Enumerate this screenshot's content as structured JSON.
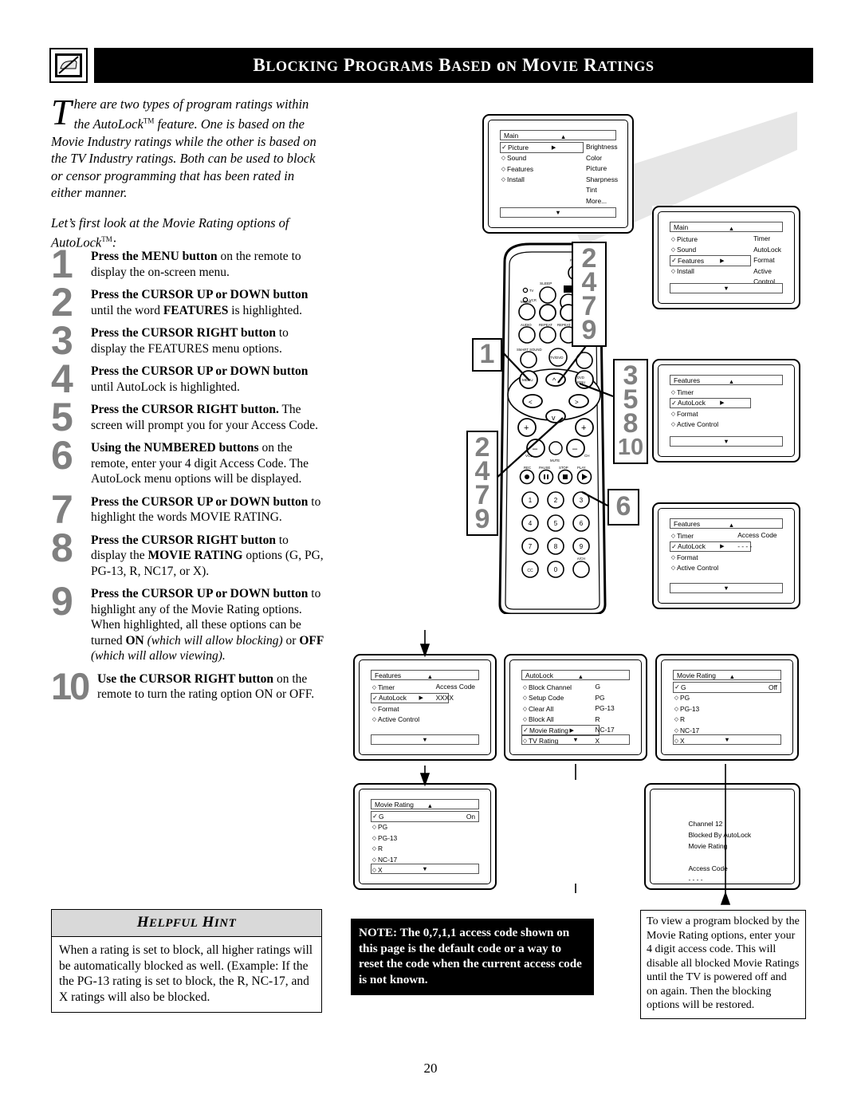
{
  "header": {
    "title": "Blocking Programs Based on Movie Ratings",
    "icon": "no-view-tv-icon"
  },
  "intro": {
    "dropcap": "T",
    "paragraph1": "here are two types of program ratings within the AutoLock™ feature. One is based on the Movie Industry ratings while the other is based on the TV Industry ratings. Both can be used to block or censor programming that has been rated in either manner.",
    "paragraph2": "Let’s first look at the Movie Rating options of AutoLock™:"
  },
  "steps": [
    {
      "num": "1",
      "html": "<b>Press the MENU button</b> on the remote to display the on-screen menu."
    },
    {
      "num": "2",
      "html": "<b>Press the CURSOR UP or DOWN button</b> until the word <b>FEATURES</b> is highlighted."
    },
    {
      "num": "3",
      "html": "<b>Press the CURSOR RIGHT button</b> to display the FEATURES menu options."
    },
    {
      "num": "4",
      "html": "<b>Press the CURSOR UP or DOWN button</b> until AutoLock is highlighted."
    },
    {
      "num": "5",
      "html": "<b>Press the CURSOR RIGHT button.</b> The screen will prompt you for your Access Code."
    },
    {
      "num": "6",
      "html": "<b>Using the NUMBERED buttons</b> on the remote, enter your 4 digit Access Code. The AutoLock menu options will be displayed."
    },
    {
      "num": "7",
      "html": "<b>Press the CURSOR UP or DOWN button</b> to highlight the words MOVIE RATING."
    },
    {
      "num": "8",
      "html": "<b>Press the CURSOR RIGHT button</b> to display the <b>MOVIE RATING</b> options (G, PG, PG-13, R, NC17, or X)."
    },
    {
      "num": "9",
      "html": "<b>Press the CURSOR UP or DOWN button</b> to highlight any of the Movie Rating options. When highlighted, all these options can be turned <b>ON</b> <i>(which will allow blocking)</i> or <b>OFF</b> <i>(which will allow viewing).</i>"
    },
    {
      "num": "10",
      "html": "<b>Use the CURSOR RIGHT button</b> on the remote to turn the rating option ON or OFF."
    }
  ],
  "hint": {
    "heading": "Helpful Hint",
    "body": "When a rating is set to block, all higher ratings will be automatically blocked as well. (Example: If the the PG-13 rating is set to block, the R, NC-17, and X ratings will also be blocked."
  },
  "note": {
    "text": "NOTE: The 0,7,1,1 access code shown on this page is the default code or a way to reset the code when the current access code is not known."
  },
  "bottom_right_note": {
    "text": "To view a program blocked by the Movie Rating options, enter your 4 digit access code. This will disable all blocked Movie Ratings until the TV is powered off and on again. Then the blocking options will be restored."
  },
  "page_number": "20",
  "callouts": [
    {
      "id": "co1",
      "values": [
        "1"
      ]
    },
    {
      "id": "co2",
      "values": [
        "2",
        "4",
        "7",
        "9"
      ]
    },
    {
      "id": "co3",
      "values": [
        "3",
        "5",
        "8",
        "10"
      ]
    },
    {
      "id": "co4",
      "values": [
        "2",
        "4",
        "7",
        "9"
      ]
    },
    {
      "id": "co5",
      "values": [
        "6"
      ]
    }
  ],
  "screens": {
    "tv1": {
      "title": "Main",
      "rows": [
        {
          "mark": "check",
          "label": "Picture",
          "arrow": true,
          "highlight": true
        },
        {
          "mark": "diamond",
          "label": "Sound"
        },
        {
          "mark": "diamond",
          "label": "Features"
        },
        {
          "mark": "diamond",
          "label": "Install"
        }
      ],
      "right_column": [
        "Brightness",
        "Color",
        "Picture",
        "Sharpness",
        "Tint",
        "More..."
      ]
    },
    "tv2": {
      "title": "Main",
      "rows": [
        {
          "mark": "diamond",
          "label": "Picture"
        },
        {
          "mark": "diamond",
          "label": "Sound"
        },
        {
          "mark": "check",
          "label": "Features",
          "arrow": true,
          "highlight": true
        },
        {
          "mark": "diamond",
          "label": "Install"
        }
      ],
      "right_column": [
        "Timer",
        "AutoLock",
        "Format",
        "Active Control"
      ]
    },
    "tv3": {
      "title": "Features",
      "rows": [
        {
          "mark": "diamond",
          "label": "Timer"
        },
        {
          "mark": "check",
          "label": "AutoLock",
          "arrow": true,
          "highlight": true
        },
        {
          "mark": "diamond",
          "label": "Format"
        },
        {
          "mark": "diamond",
          "label": "Active Control"
        }
      ],
      "right_column": []
    },
    "tv4": {
      "title": "Features",
      "rows": [
        {
          "mark": "diamond",
          "label": "Timer"
        },
        {
          "mark": "check",
          "label": "AutoLock",
          "arrow": true,
          "highlight": true
        },
        {
          "mark": "diamond",
          "label": "Format"
        },
        {
          "mark": "diamond",
          "label": "Active Control"
        }
      ],
      "right_column": [
        "Access Code",
        "- - - -"
      ]
    },
    "tv5": {
      "title": "Features",
      "rows": [
        {
          "mark": "diamond",
          "label": "Timer"
        },
        {
          "mark": "check",
          "label": "AutoLock",
          "arrow": true,
          "highlight": true
        },
        {
          "mark": "diamond",
          "label": "Format"
        },
        {
          "mark": "diamond",
          "label": "Active Control"
        }
      ],
      "right_column": [
        "Access Code",
        "XXXX"
      ]
    },
    "tv6": {
      "title": "AutoLock",
      "rows": [
        {
          "mark": "diamond",
          "label": "Block Channel"
        },
        {
          "mark": "diamond",
          "label": "Setup Code"
        },
        {
          "mark": "diamond",
          "label": "Clear All"
        },
        {
          "mark": "diamond",
          "label": "Block All"
        },
        {
          "mark": "check",
          "label": "Movie Rating",
          "arrow": true,
          "highlight": true
        },
        {
          "mark": "diamond",
          "label": "TV Rating"
        }
      ],
      "right_column": [
        "G",
        "PG",
        "PG-13",
        "R",
        "NC-17",
        "X"
      ]
    },
    "tv7": {
      "title": "Movie Rating",
      "rows": [
        {
          "mark": "check",
          "label": "G",
          "highlight": true,
          "value": "Off"
        },
        {
          "mark": "diamond",
          "label": "PG"
        },
        {
          "mark": "diamond",
          "label": "PG-13"
        },
        {
          "mark": "diamond",
          "label": "R"
        },
        {
          "mark": "diamond",
          "label": "NC-17"
        },
        {
          "mark": "diamond",
          "label": "X"
        }
      ],
      "right_column": []
    },
    "tv8": {
      "title": "Movie Rating",
      "rows": [
        {
          "mark": "check",
          "label": "G",
          "highlight": true,
          "value": "On"
        },
        {
          "mark": "diamond",
          "label": "PG"
        },
        {
          "mark": "diamond",
          "label": "PG-13"
        },
        {
          "mark": "diamond",
          "label": "R"
        },
        {
          "mark": "diamond",
          "label": "NC-17"
        },
        {
          "mark": "diamond",
          "label": "X"
        }
      ],
      "right_column": []
    },
    "tv9": {
      "message_lines": [
        "Channel 12",
        "Blocked By AutoLock",
        "Movie Rating",
        "",
        "Access Code",
        "- - - -"
      ]
    }
  },
  "remote": {
    "labels": {
      "tv": "TV",
      "vcr": "VCR",
      "mode": "MODE",
      "sleep": "SLEEP",
      "audio": "AUDIO",
      "repeat": "REPEAT",
      "repeat_ab": "REPEAT A-B",
      "smart_sound": "SMART SOUND",
      "tv_dvd": "TV/DVD",
      "menu": "MENU",
      "dvd_menu": "DVD MENU",
      "vol": "VOL",
      "ch": "CH",
      "mute": "MUTE",
      "rec": "REC",
      "pause": "PAUSE",
      "stop": "STOP",
      "play": "PLAY",
      "cc": "CC",
      "a_ch": "A/CH"
    },
    "keypad": [
      "1",
      "2",
      "3",
      "4",
      "5",
      "6",
      "7",
      "8",
      "9",
      "CC",
      "0",
      "A/CH"
    ]
  },
  "colors": {
    "accent_gray": "#808080",
    "hint_header": "#d9d9d9",
    "black": "#000000"
  }
}
